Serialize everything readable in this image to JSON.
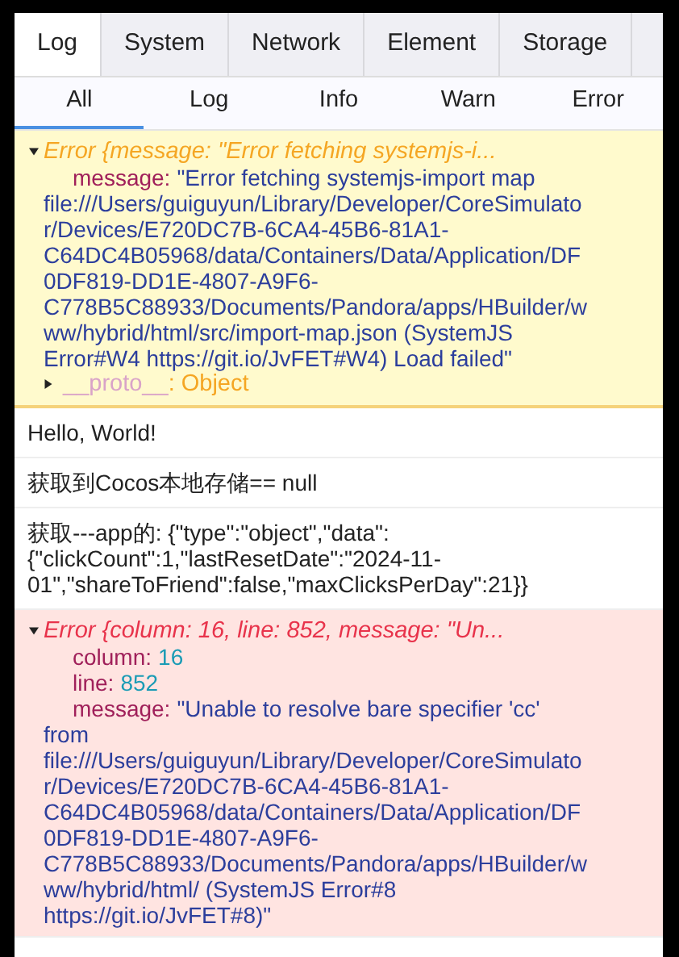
{
  "tabs": [
    {
      "label": "Log",
      "selected": true
    },
    {
      "label": "System",
      "selected": false
    },
    {
      "label": "Network",
      "selected": false
    },
    {
      "label": "Element",
      "selected": false
    },
    {
      "label": "Storage",
      "selected": false
    }
  ],
  "filters": [
    {
      "label": "All",
      "selected": true
    },
    {
      "label": "Log",
      "selected": false
    },
    {
      "label": "Info",
      "selected": false
    },
    {
      "label": "Warn",
      "selected": false
    },
    {
      "label": "Error",
      "selected": false
    }
  ],
  "entries": [
    {
      "kind": "warn",
      "expanded": true,
      "summary": "Error {message: \"Error fetching systemjs-i...",
      "properties": [
        {
          "key": "message:",
          "kind": "string",
          "value": "\"Error fetching systemjs-import map file:///Users/guiguyun/Library/Developer/CoreSimulator/Devices/E720DC7B-6CA4-45B6-81A1-C64DC4B05968/data/Containers/Data/Application/DF0DF819-DD1E-4807-A9F6-C778B5C88933/Documents/Pandora/apps/HBuilder/www/hybrid/html/src/import-map.json (SystemJS Error#W4 https://git.io/JvFET#W4) Load failed\""
        }
      ],
      "proto": {
        "key": "__proto__",
        "value": ": Object",
        "expanded": false
      }
    },
    {
      "kind": "log",
      "text": "Hello, World!"
    },
    {
      "kind": "log",
      "text": "获取到Cocos本地存储== null"
    },
    {
      "kind": "log",
      "text": "获取---app的: {\"type\":\"object\",\"data\":{\"clickCount\":1,\"lastResetDate\":\"2024-11-01\",\"shareToFriend\":false,\"maxClicksPerDay\":21}}"
    },
    {
      "kind": "error",
      "expanded": true,
      "summary": "Error {column: 16, line: 852, message: \"Un...",
      "properties": [
        {
          "key": "column:",
          "kind": "number",
          "value": "16"
        },
        {
          "key": "line:",
          "kind": "number",
          "value": "852"
        },
        {
          "key": "message:",
          "kind": "string",
          "value": "\"Unable to resolve bare specifier 'cc' from file:///Users/guiguyun/Library/Developer/CoreSimulator/Devices/E720DC7B-6CA4-45B6-81A1-C64DC4B05968/data/Containers/Data/Application/DF0DF819-DD1E-4807-A9F6-C778B5C88933/Documents/Pandora/apps/HBuilder/www/hybrid/html/ (SystemJS Error#8 https://git.io/JvFET#8)\""
        }
      ]
    }
  ]
}
